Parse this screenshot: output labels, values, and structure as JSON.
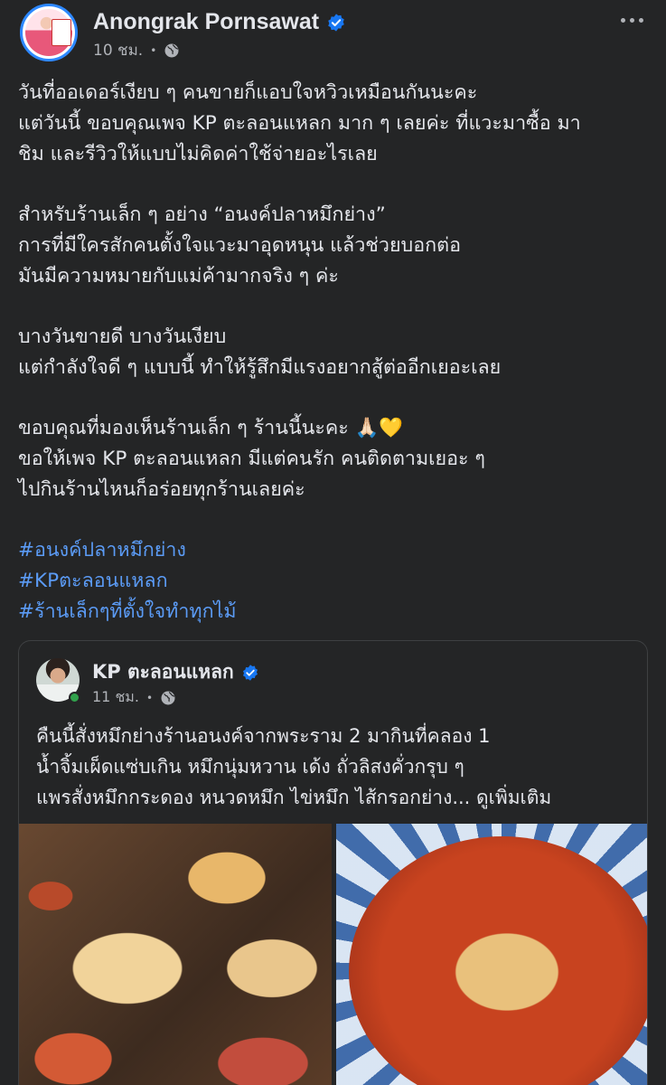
{
  "post": {
    "author": "Anongrak Pornsawat",
    "time": "10 ชม.",
    "body_lines": [
      "วันที่ออเดอร์เงียบ ๆ คนขายก็แอบใจหวิวเหมือนกันนะคะ",
      "แต่วันนี้ ขอบคุณเพจ KP ตะลอนแหลก มาก ๆ เลยค่ะ ที่แวะมาซื้อ มา",
      "ชิม และรีวิวให้แบบไม่คิดค่าใช้จ่ายอะไรเลย",
      "",
      "สำหรับร้านเล็ก ๆ อย่าง “อนงค์ปลาหมึกย่าง”",
      "การที่มีใครสักคนตั้งใจแวะมาอุดหนุน แล้วช่วยบอกต่อ",
      "มันมีความหมายกับแม่ค้ามากจริง ๆ ค่ะ",
      "",
      "บางวันขายดี บางวันเงียบ",
      "แต่กำลังใจดี ๆ แบบนี้ ทำให้รู้สึกมีแรงอยากสู้ต่ออีกเยอะเลย",
      "",
      "ขอบคุณที่มองเห็นร้านเล็ก ๆ ร้านนี้นะคะ 🙏🏻💛",
      "ขอให้เพจ KP ตะลอนแหลก มีแต่คนรัก คนติดตามเยอะ ๆ",
      "ไปกินร้านไหนก็อร่อยทุกร้านเลยค่ะ"
    ],
    "hashtags": [
      "#อนงค์ปลาหมึกย่าง",
      "#KPตะลอนแหลก",
      "#ร้านเล็กๆที่ตั้งใจทำทุกไม้"
    ]
  },
  "shared": {
    "author": "KP ตะลอนแหลก",
    "time": "11 ชม.",
    "lines": [
      "คืนนี้สั่งหมึกย่างร้านอนงค์จากพระราม 2 มากินที่คลอง 1",
      "น้ำจิ้มเผ็ดแซ่บเกิน หมึกนุ่มหวาน เด้ง ถั่วลิสงคั่วกรุบ ๆ",
      "แพรสั่งหมึกกระดอง หนวดหมึก ไข่หมึก ไส้กรอกย่าง..."
    ],
    "see_more": "ดูเพิ่มเติม"
  },
  "icons": {
    "verified": "verified-badge-icon",
    "privacy": "globe-icon",
    "menu": "more-options-icon"
  },
  "colors": {
    "background": "#242526",
    "hashtag": "#5b9bf5",
    "verified": "#1877f2",
    "online": "#31a24c"
  }
}
